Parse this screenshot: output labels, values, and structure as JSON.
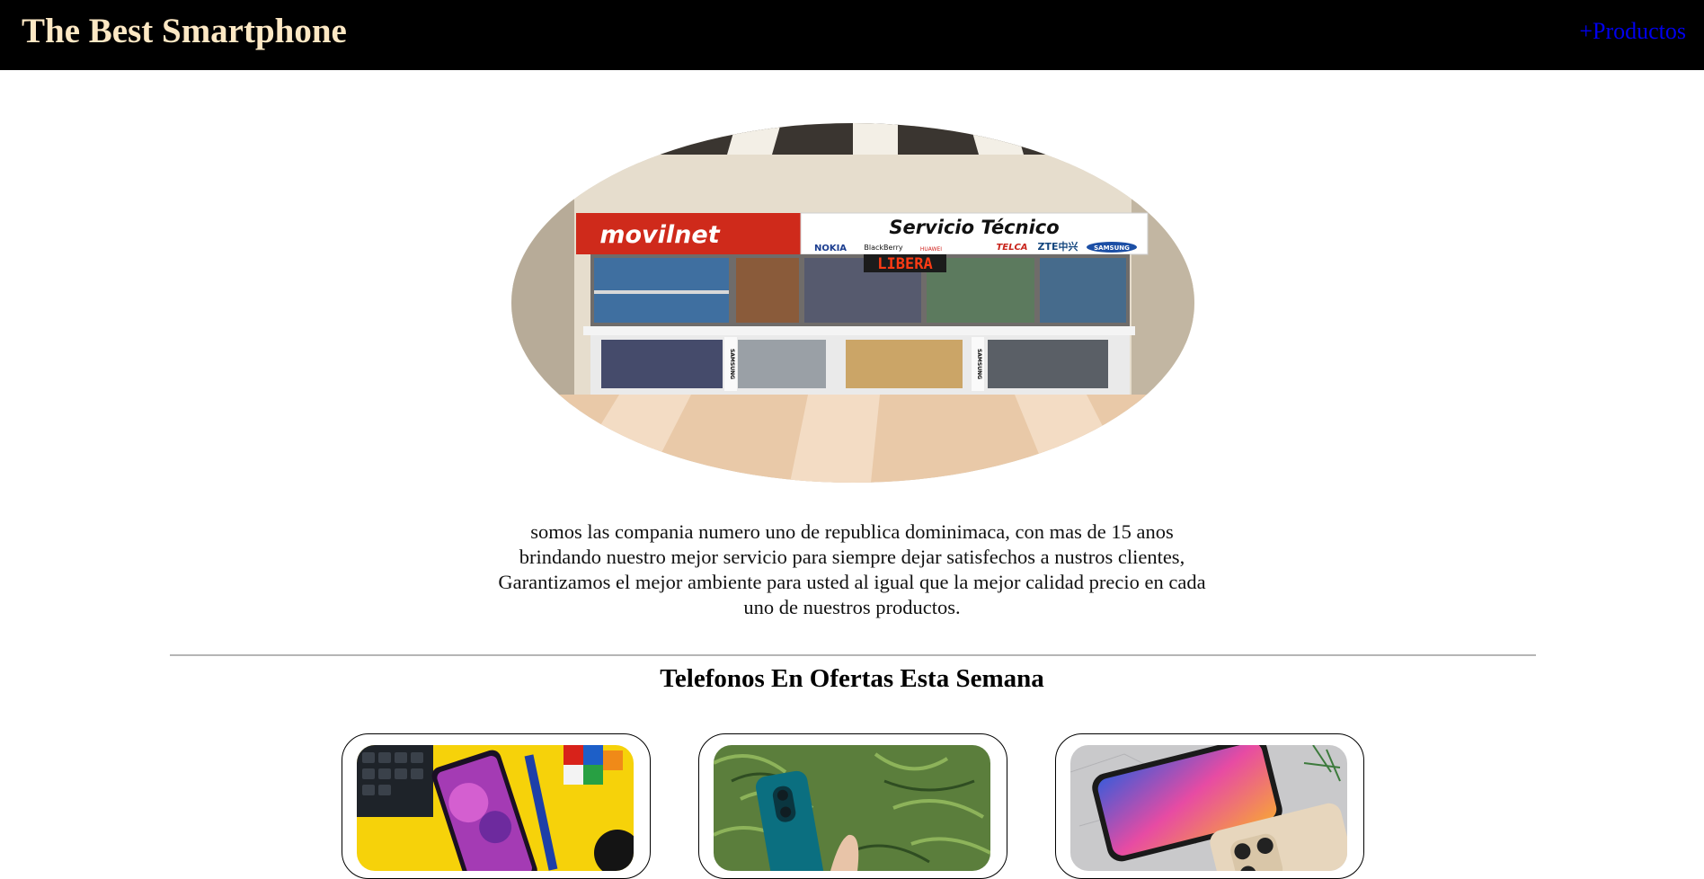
{
  "header": {
    "title": "The Best Smartphone",
    "nav_link": "+Productos"
  },
  "hero": {
    "sign_brand": "movilnet",
    "sign_service": "Servicio Técnico",
    "sign_led": "LIBERA",
    "sign_logos": [
      "NOKIA",
      "BlackBerry",
      "HUAWEI",
      "TELCA",
      "ZTE中兴",
      "SAMSUNG"
    ],
    "cabinet_labels": [
      "SAMSUNG",
      "SAMSUNG"
    ]
  },
  "intro": {
    "text": "somos las compania numero uno de republica dominimaca, con mas de 15 anos brindando nuestro mejor servicio para siempre dejar satisfechos a nustros clientes, Garantizamos el mejor ambiente para usted al igual que la mejor calidad precio en cada uno de nuestros productos."
  },
  "offers": {
    "title": "Telefonos En Ofertas Esta Semana"
  },
  "colors": {
    "header_bg": "#000000",
    "title_color": "#fde8c4",
    "link_color": "#0000ee"
  }
}
